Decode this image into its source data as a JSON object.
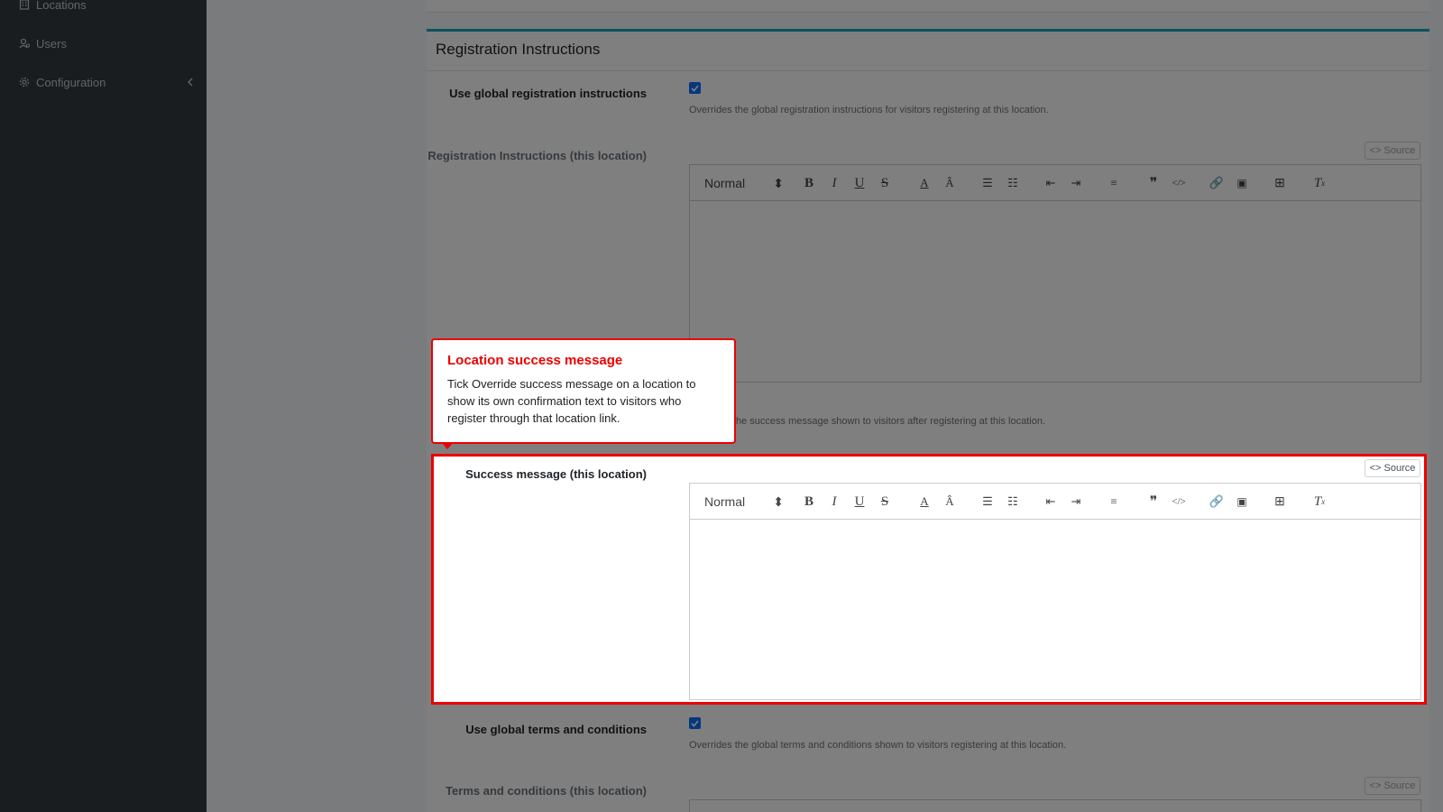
{
  "sidebar": {
    "items": [
      {
        "label": "Locations",
        "icon": "building-icon"
      },
      {
        "label": "Users",
        "icon": "users-cog-icon"
      },
      {
        "label": "Configuration",
        "icon": "gear-icon"
      }
    ]
  },
  "section": {
    "title": "Registration Instructions"
  },
  "fields": {
    "use_global_registration": {
      "label": "Use global registration instructions",
      "checked": true,
      "help": "Overrides the global registration instructions for visitors registering at this location."
    },
    "registration_instructions": {
      "label": "Registration Instructions (this location)"
    },
    "success_override": {
      "help_visible": "he success message shown to visitors after registering at this location."
    },
    "success_message": {
      "label": "Success message (this location)"
    },
    "use_global_terms": {
      "label": "Use global terms and conditions",
      "checked": true,
      "help": "Overrides the global terms and conditions shown to visitors registering at this location."
    },
    "terms": {
      "label": "Terms and conditions (this location)"
    }
  },
  "editor": {
    "source_label": "<> Source",
    "format_select": "Normal"
  },
  "tooltip": {
    "title": "Location success message",
    "body": "Tick Override success message on a location to show its own confirmation text to visitors who register through that location link."
  },
  "colors": {
    "sidebar_bg": "#343a40",
    "accent": "#17a2b8",
    "highlight": "#e00000",
    "checkbox": "#0d6efd"
  }
}
